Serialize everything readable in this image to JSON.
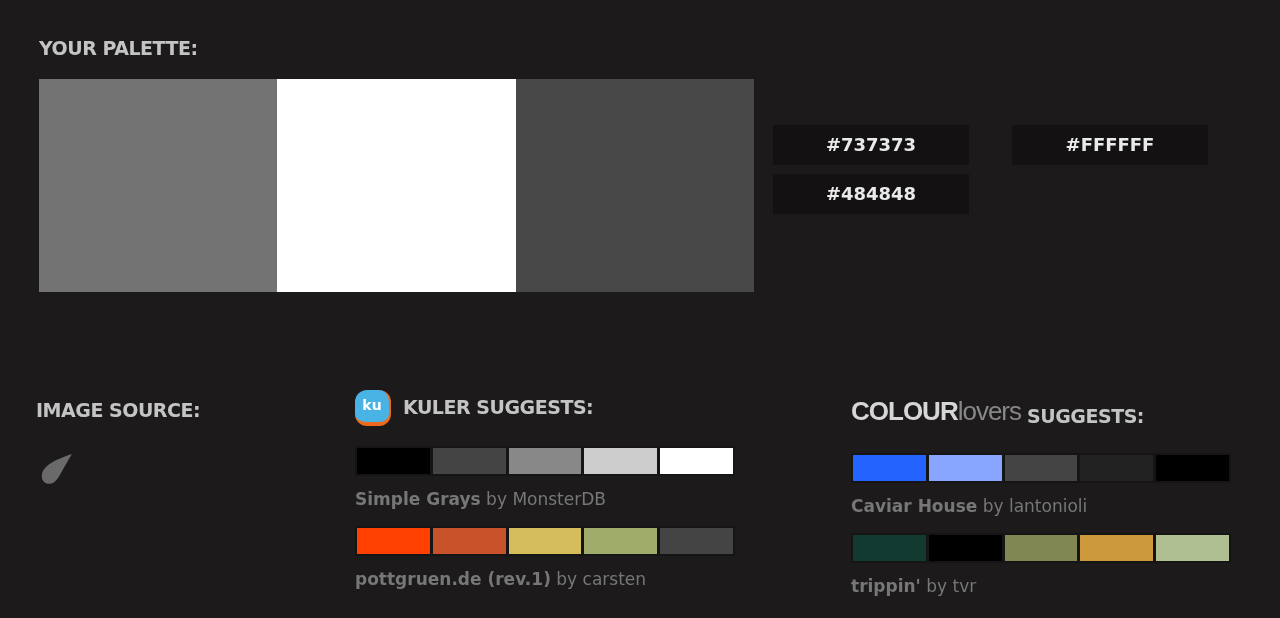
{
  "palette": {
    "title": "YOUR PALETTE:",
    "swatches": [
      {
        "color": "#737373"
      },
      {
        "color": "#ffffff"
      },
      {
        "color": "#484848"
      }
    ],
    "hex_codes": [
      "#737373",
      "#FFFFFF",
      "#484848"
    ]
  },
  "image_source": {
    "title": "IMAGE SOURCE:"
  },
  "kuler": {
    "logo": "ku",
    "title": "KULER SUGGESTS:",
    "palettes": [
      {
        "label": "**Simple Grays** by MonsterDB",
        "colors": [
          {
            "color": "#000000"
          },
          {
            "color": "#444444"
          },
          {
            "color": "#888888"
          },
          {
            "color": "#cccccc"
          },
          {
            "color": "#ffffff"
          }
        ]
      },
      {
        "label": "**pottgruen.de (rev.1)** by carsten",
        "colors": [
          {
            "color": "#ff4000"
          },
          {
            "color": "#c8522a"
          },
          {
            "color": "#d4bd5a"
          },
          {
            "color": "#a0ac6a"
          },
          {
            "color": "#444444"
          }
        ]
      }
    ]
  },
  "colourlovers": {
    "logo_bold": "COLOUR",
    "logo_light": "lovers",
    "title": "SUGGESTS:",
    "palettes": [
      {
        "label": "**Caviar House** by lantonioli",
        "colors": [
          {
            "color": "#2563ff"
          },
          {
            "color": "#88a6ff"
          },
          {
            "color": "#444444"
          },
          {
            "color": "#222222"
          },
          {
            "color": "#000000"
          }
        ]
      },
      {
        "label": "**trippin'** by tvr",
        "colors": [
          {
            "color": "#123a30"
          },
          {
            "color": "#000000"
          },
          {
            "color": "#808752"
          },
          {
            "color": "#cc9a3c"
          },
          {
            "color": "#b0bf92"
          }
        ]
      }
    ]
  }
}
